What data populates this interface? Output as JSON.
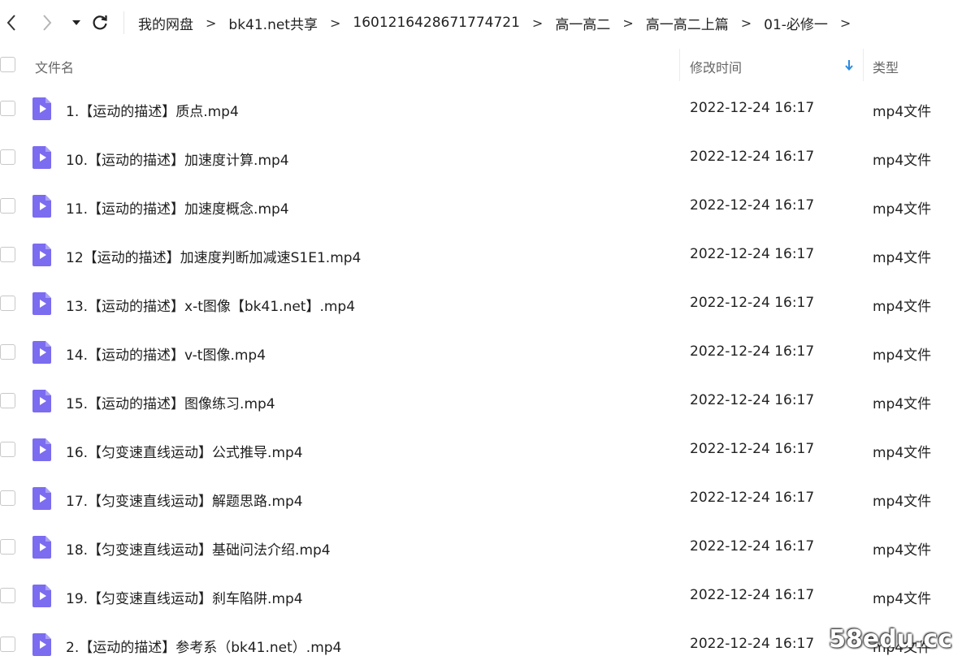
{
  "toolbar": {
    "back_icon": "chevron-left-icon",
    "forward_icon": "chevron-right-icon",
    "history_icon": "caret-down-icon",
    "refresh_icon": "refresh-icon"
  },
  "breadcrumb": [
    "我的网盘",
    "bk41.net共享",
    "1601216428671774721",
    "高一高二",
    "高一高二上篇",
    "01-必修一"
  ],
  "breadcrumb_separator": ">",
  "columns": {
    "name": "文件名",
    "modified": "修改时间",
    "type": "类型"
  },
  "sort": {
    "column": "modified",
    "direction": "descending",
    "icon": "arrow-down-icon"
  },
  "files": [
    {
      "name": "1.【运动的描述】质点.mp4",
      "modified": "2022-12-24 16:17",
      "type": "mp4文件"
    },
    {
      "name": "10.【运动的描述】加速度计算.mp4",
      "modified": "2022-12-24 16:17",
      "type": "mp4文件"
    },
    {
      "name": "11.【运动的描述】加速度概念.mp4",
      "modified": "2022-12-24 16:17",
      "type": "mp4文件"
    },
    {
      "name": "12【运动的描述】加速度判断加减速S1E1.mp4",
      "modified": "2022-12-24 16:17",
      "type": "mp4文件"
    },
    {
      "name": "13.【运动的描述】x-t图像【bk41.net】.mp4",
      "modified": "2022-12-24 16:17",
      "type": "mp4文件"
    },
    {
      "name": "14.【运动的描述】v-t图像.mp4",
      "modified": "2022-12-24 16:17",
      "type": "mp4文件"
    },
    {
      "name": "15.【运动的描述】图像练习.mp4",
      "modified": "2022-12-24 16:17",
      "type": "mp4文件"
    },
    {
      "name": "16.【匀变速直线运动】公式推导.mp4",
      "modified": "2022-12-24 16:17",
      "type": "mp4文件"
    },
    {
      "name": "17.【匀变速直线运动】解题思路.mp4",
      "modified": "2022-12-24 16:17",
      "type": "mp4文件"
    },
    {
      "name": "18.【匀变速直线运动】基础问法介绍.mp4",
      "modified": "2022-12-24 16:17",
      "type": "mp4文件"
    },
    {
      "name": "19.【匀变速直线运动】刹车陷阱.mp4",
      "modified": "2022-12-24 16:17",
      "type": "mp4文件"
    },
    {
      "name": "2.【运动的描述】参考系（bk41.net）.mp4",
      "modified": "2022-12-24 16:17",
      "type": "mp4文件"
    }
  ],
  "file_icon": "video-file-icon",
  "colors": {
    "video_icon": "#7b6cf0",
    "sort_arrow": "#2b8ae2"
  },
  "watermark": "58edu.cc"
}
